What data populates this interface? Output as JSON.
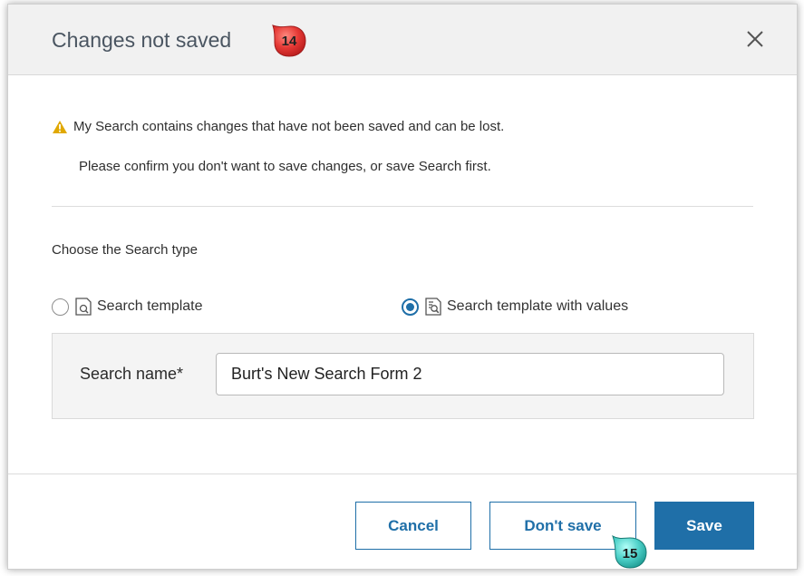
{
  "dialog": {
    "title": "Changes not saved",
    "close_icon": "close-icon"
  },
  "callouts": {
    "step_title": "14",
    "step_dont_save": "15"
  },
  "message": {
    "warning_icon": "warning-icon",
    "warning_text": "My Search contains changes that have not been saved and can be lost.",
    "confirm_text": "Please confirm you don't want to save changes, or save Search first."
  },
  "search_type": {
    "label": "Choose the Search type",
    "options": [
      {
        "label": "Search template",
        "icon": "search-template-icon",
        "selected": false
      },
      {
        "label": "Search template with values",
        "icon": "search-template-values-icon",
        "selected": true
      }
    ]
  },
  "search_name": {
    "label": "Search name*",
    "value": "Burt's New Search Form 2"
  },
  "buttons": {
    "cancel": "Cancel",
    "dont_save": "Don't save",
    "save": "Save"
  },
  "colors": {
    "accent": "#1f6fa8",
    "callout_red": "#e53935",
    "callout_teal": "#4dd0c8",
    "warning": "#e0a800"
  }
}
